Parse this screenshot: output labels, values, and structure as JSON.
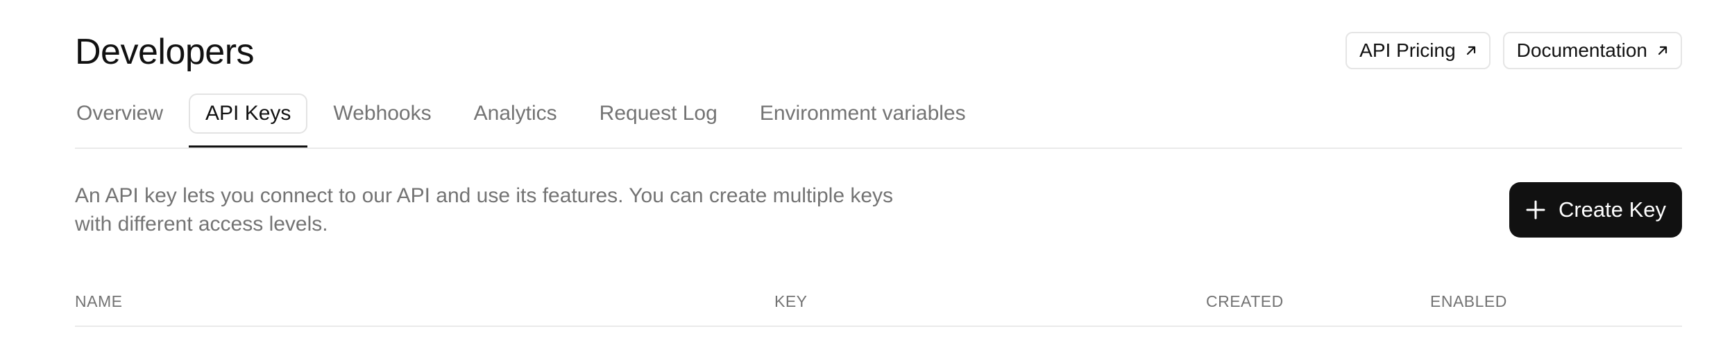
{
  "header": {
    "title": "Developers",
    "links": [
      {
        "label": "API Pricing",
        "icon": "arrow-up-right-icon"
      },
      {
        "label": "Documentation",
        "icon": "arrow-up-right-icon"
      }
    ]
  },
  "tabs": [
    {
      "label": "Overview"
    },
    {
      "label": "API Keys",
      "active": true
    },
    {
      "label": "Webhooks"
    },
    {
      "label": "Analytics"
    },
    {
      "label": "Request Log"
    },
    {
      "label": "Environment variables"
    }
  ],
  "main": {
    "description": "An API key lets you connect to our API and use its features. You can create multiple keys with different access levels.",
    "create_button": {
      "label": "Create Key",
      "icon": "plus-icon"
    }
  },
  "table": {
    "columns": [
      "NAME",
      "KEY",
      "CREATED",
      "ENABLED"
    ]
  },
  "colors": {
    "primary": "#111111",
    "muted_text": "#737373",
    "border": "#e5e5e5"
  }
}
